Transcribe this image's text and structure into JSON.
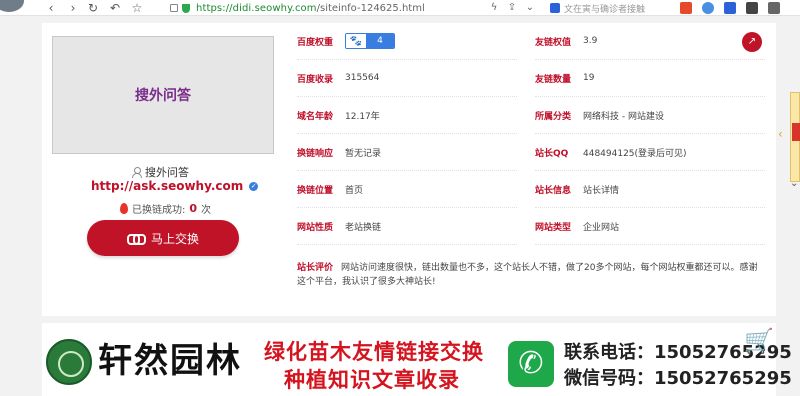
{
  "browser": {
    "url_host": "https://didi.seowhy.com",
    "url_path": "/siteinfo-124625.html",
    "search_placeholder": "文在寅与确诊者接触"
  },
  "site": {
    "thumbnail_text": "搜外问答",
    "name": "搜外问答",
    "url": "http://ask.seowhy.com",
    "swap_label": "已换链成功:",
    "swap_count": "0",
    "swap_unit": "次",
    "exchange_button": "马上交换"
  },
  "info": {
    "baidu_weight_label": "百度权重",
    "baidu_weight_value": "4",
    "friend_weight_label": "友链权值",
    "friend_weight_value": "3.9",
    "baidu_index_label": "百度收录",
    "baidu_index_value": "315564",
    "friend_count_label": "友链数量",
    "friend_count_value": "19",
    "domain_age_label": "域名年龄",
    "domain_age_value": "12.17年",
    "category_label": "所属分类",
    "category_value": "网络科技 - 网站建设",
    "response_label": "换链响应",
    "response_value": "暂无记录",
    "qq_label": "站长QQ",
    "qq_value": "448494125(登录后可见)",
    "position_label": "换链位置",
    "position_value": "首页",
    "owner_info_label": "站长信息",
    "owner_info_value": "站长详情",
    "site_nature_label": "网站性质",
    "site_nature_value": "老站换链",
    "site_type_label": "网站类型",
    "site_type_value": "企业网站",
    "review_label": "站长评价",
    "review_value": "网站访问速度很快，链出数量也不多，这个站长人不错，做了20多个网站，每个网站权重都还可以。感谢这个平台，我认识了很多大神站长!"
  },
  "banner": {
    "brand": "轩然园林",
    "slogan_line1": "绿化苗木友情链接交换",
    "slogan_line2": "种植知识文章收录",
    "contact_line1": "联系电话：15052765295",
    "contact_line2": "微信号码：15052765295"
  }
}
